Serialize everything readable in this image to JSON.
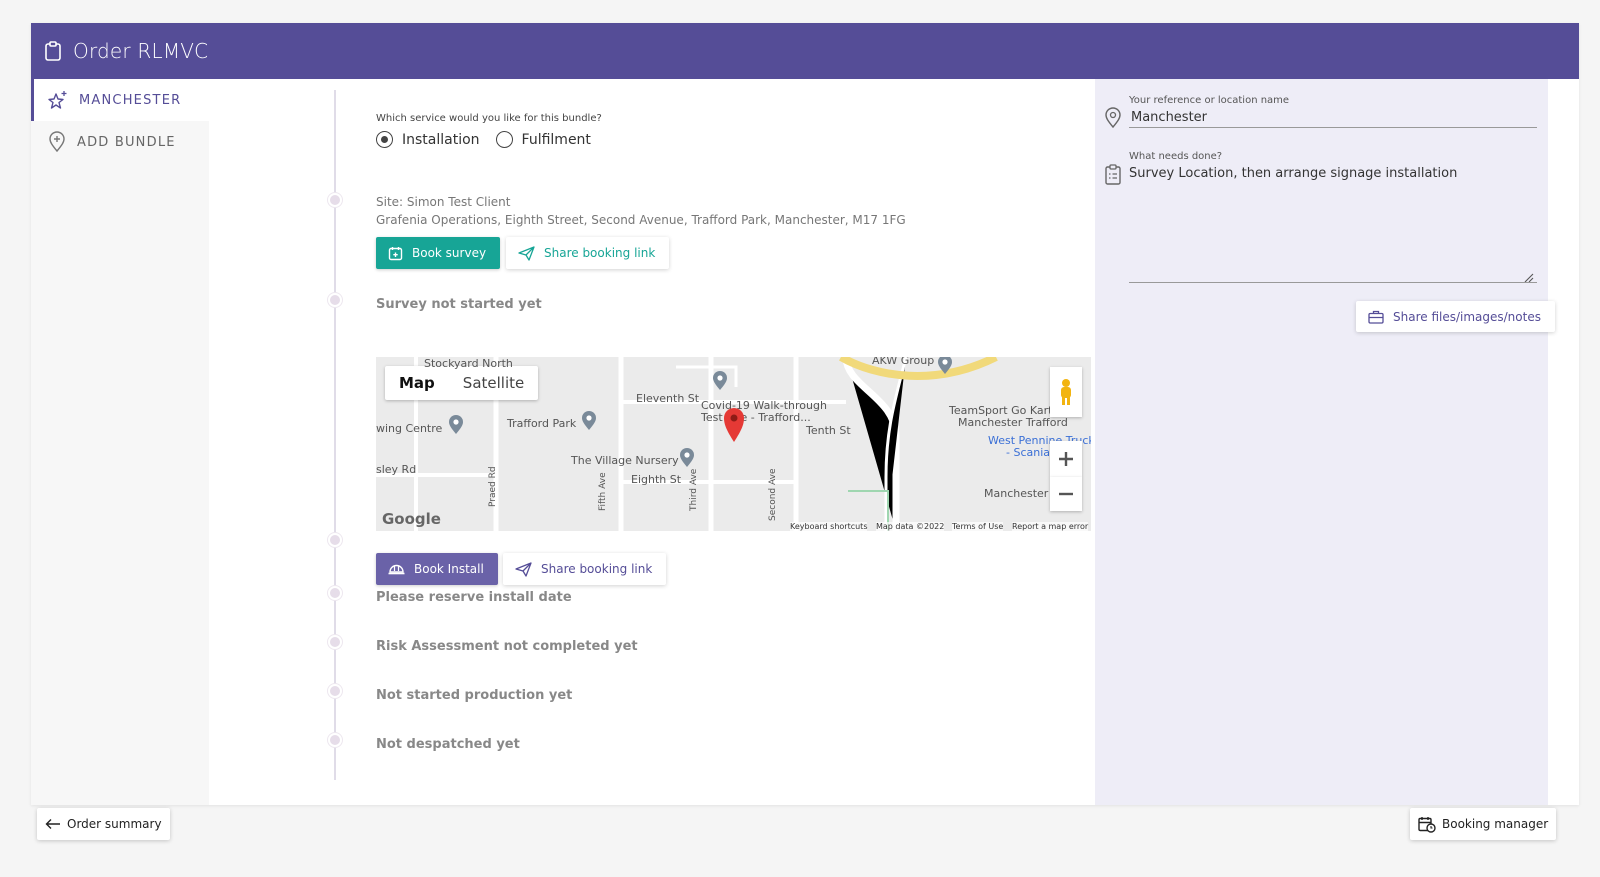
{
  "header": {
    "title": "Order RLMVC"
  },
  "sidebar": {
    "items": [
      {
        "label": "MANCHESTER",
        "active": true
      },
      {
        "label": "ADD BUNDLE",
        "active": false
      }
    ]
  },
  "service": {
    "question": "Which service would you like for this bundle?",
    "options": [
      {
        "label": "Installation",
        "selected": true
      },
      {
        "label": "Fulfilment",
        "selected": false
      }
    ]
  },
  "site": {
    "name": "Site: Simon Test Client",
    "address": "Grafenia Operations, Eighth Street, Second Avenue, Trafford Park, Manchester, M17 1FG"
  },
  "survey": {
    "book_label": "Book survey",
    "share_label": "Share booking link",
    "status": "Survey not started yet"
  },
  "map": {
    "tab_map": "Map",
    "tab_satellite": "Satellite",
    "labels": [
      "Stockyard North",
      "Eleventh St",
      "AKW Group",
      "Covid-19 Walk-through",
      "Test Site - Trafford...",
      "Tenth St",
      "Trafford Park",
      "wing Centre",
      "TeamSport Go Karting",
      "Manchester Trafford",
      "West Pennine Truck",
      "- Scania",
      "The Village Nursery",
      "Eighth St",
      "sley Rd",
      "Manchester",
      "Fifth Ave",
      "Third Ave",
      "Praed Rd",
      "Second Ave"
    ],
    "brand": "Google",
    "footer": {
      "shortcuts": "Keyboard shortcuts",
      "data": "Map data ©2022",
      "terms": "Terms of Use",
      "report": "Report a map error"
    }
  },
  "install": {
    "book_label": "Book Install",
    "share_label": "Share booking link"
  },
  "statuses": [
    "Please reserve install date",
    "Risk Assessment not completed yet",
    "Not started production yet",
    "Not despatched yet"
  ],
  "right_panel": {
    "reference_label": "Your reference or location name",
    "reference_value": "Manchester",
    "needs_label": "What needs done?",
    "needs_value": "Survey Location,  then arrange signage installation",
    "share_files_label": "Share files/images/notes"
  },
  "footer": {
    "order_summary_label": "Order summary",
    "booking_manager_label": "Booking manager"
  },
  "colors": {
    "header": "#554d97",
    "green": "#17a596",
    "purple": "#6a62a8",
    "right_panel_bg": "#eeedf7"
  }
}
